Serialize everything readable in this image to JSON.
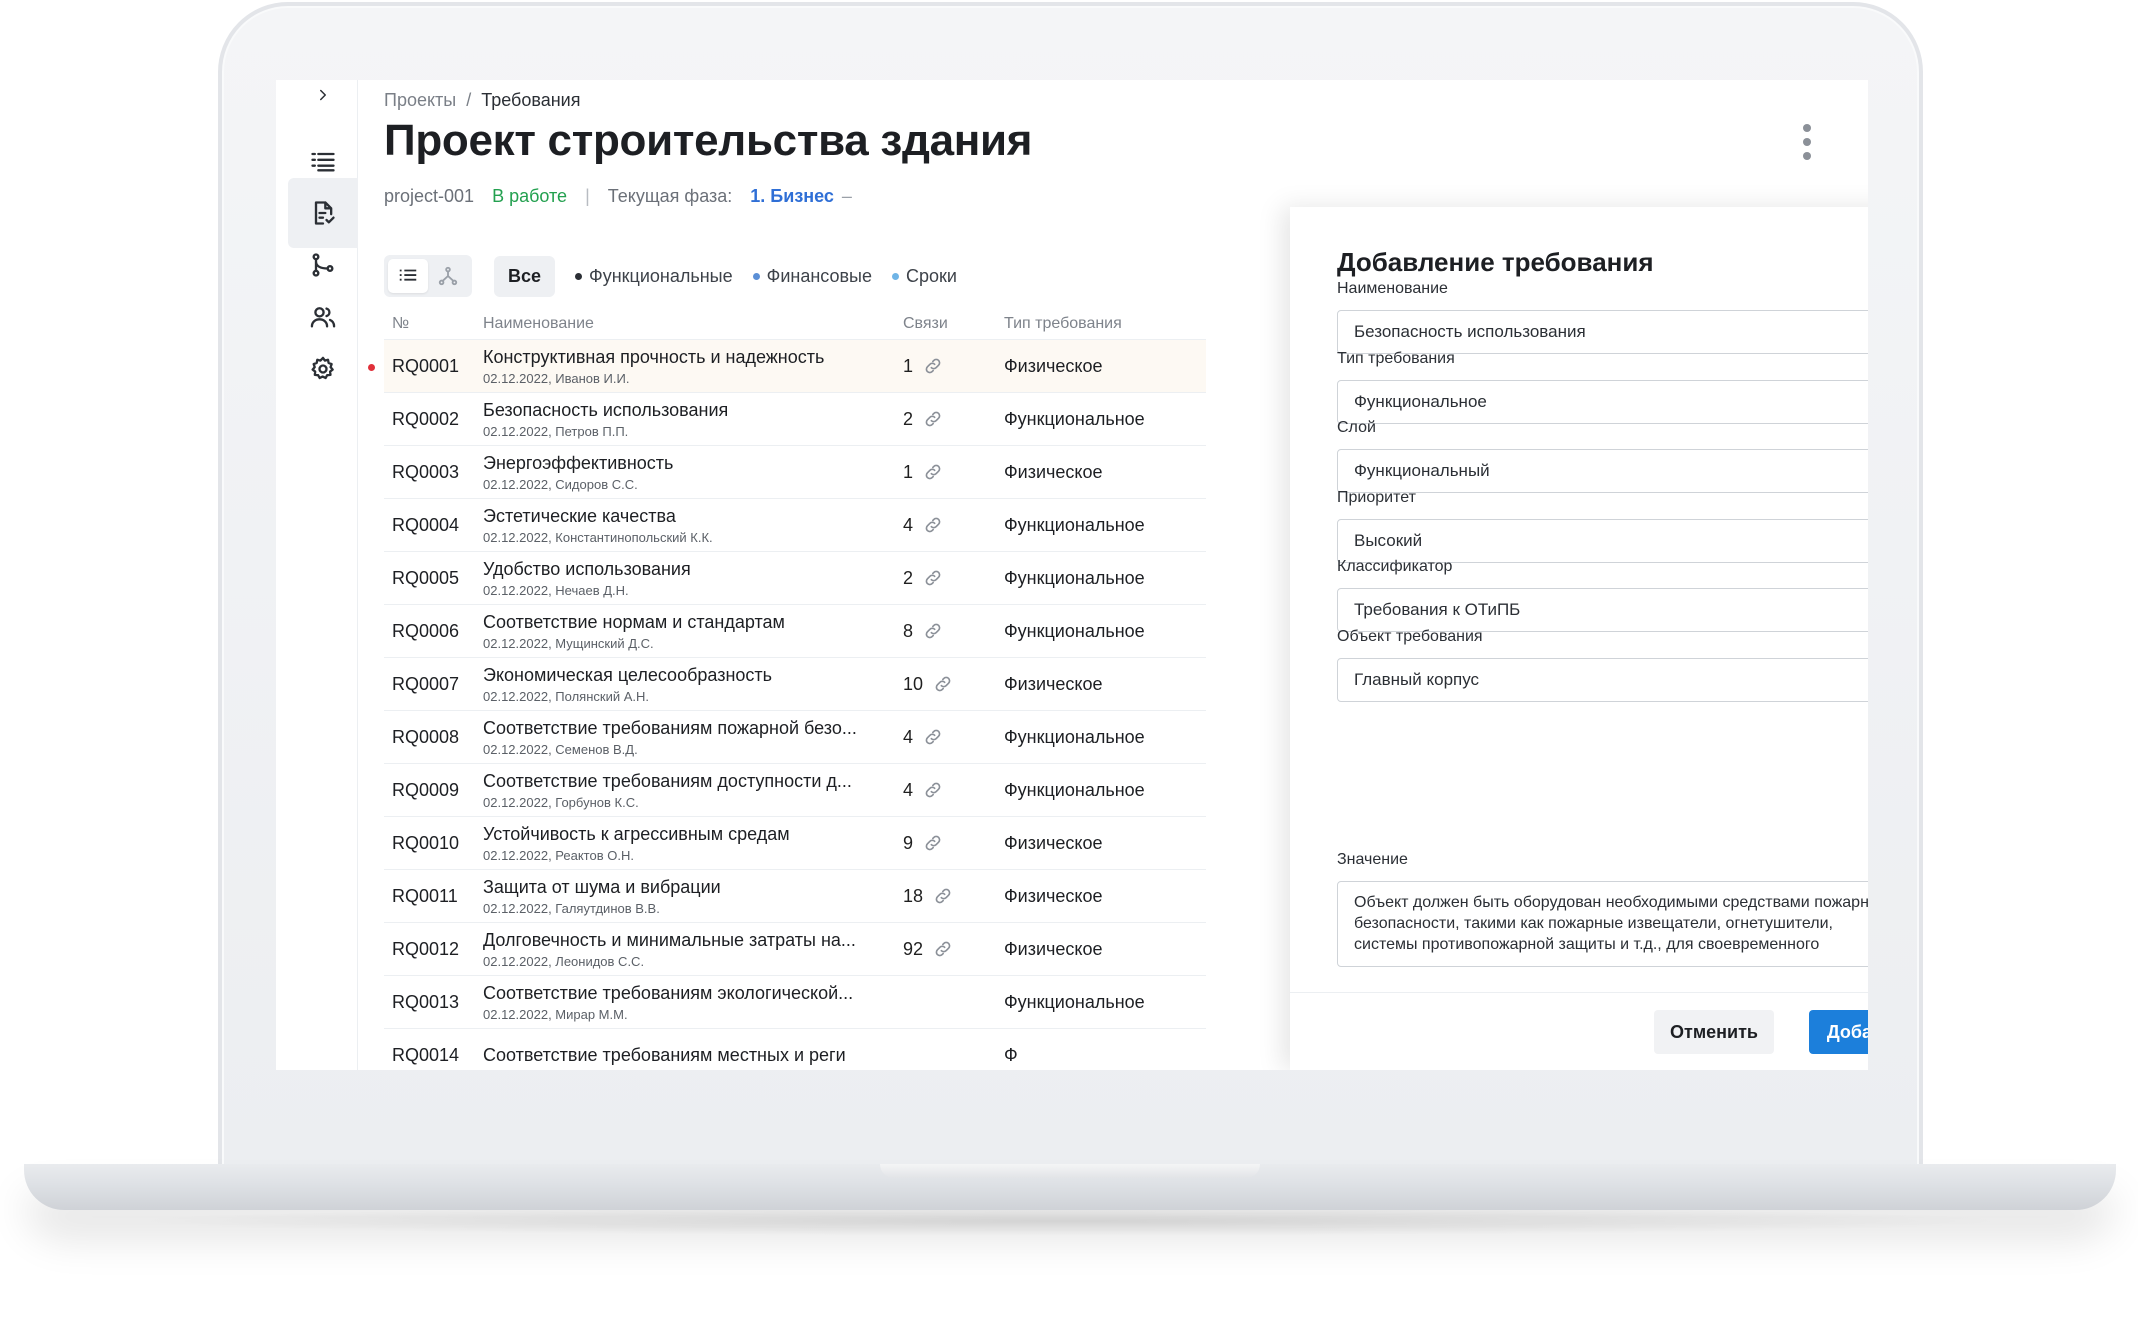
{
  "colors": {
    "accent": "#1c7fdb",
    "status_active": "#23a04f",
    "phase": "#2f6fd6",
    "alert_dot": "#e0303a"
  },
  "rail": {
    "expand_icon": "chevron-right-icon",
    "items": [
      {
        "icon": "list-icon",
        "active": false
      },
      {
        "icon": "document-check-icon",
        "active": true
      },
      {
        "icon": "branch-icon",
        "active": false
      },
      {
        "icon": "users-icon",
        "active": false
      },
      {
        "icon": "gear-icon",
        "active": false
      }
    ]
  },
  "header": {
    "breadcrumb": {
      "root": "Проекты",
      "separator": "/",
      "current": "Требования"
    },
    "title": "Проект строительства здания",
    "project_id": "project-001",
    "status": "В работе",
    "divider": "|",
    "phase_label": "Текущая фаза:",
    "phase_value": "1. Бизнес",
    "phase_dash": "–"
  },
  "toolbar": {
    "filters": [
      {
        "label": "Все",
        "active": true
      },
      {
        "label": "Функциональные",
        "dot_color": "#2b2f35"
      },
      {
        "label": "Финансовые",
        "dot_color": "#5b8fd6"
      },
      {
        "label": "Сроки",
        "dot_color": "#6fb4e6"
      }
    ]
  },
  "table": {
    "columns": [
      "№",
      "Наименование",
      "Связи",
      "Тип требования"
    ],
    "rows": [
      {
        "num": "RQ0001",
        "title": "Конструктивная прочность и надежность",
        "sub": "02.12.2022, Иванов И.И.",
        "links": "1",
        "type": "Физическое",
        "flag": true
      },
      {
        "num": "RQ0002",
        "title": "Безопасность использования",
        "sub": "02.12.2022, Петров П.П.",
        "links": "2",
        "type": "Функциональное"
      },
      {
        "num": "RQ0003",
        "title": "Энергоэффективность",
        "sub": "02.12.2022, Сидоров С.С.",
        "links": "1",
        "type": "Физическое"
      },
      {
        "num": "RQ0004",
        "title": "Эстетические качества",
        "sub": "02.12.2022, Константинопольский К.К.",
        "links": "4",
        "type": "Функциональное"
      },
      {
        "num": "RQ0005",
        "title": "Удобство использования",
        "sub": "02.12.2022, Нечаев Д.Н.",
        "links": "2",
        "type": "Функциональное"
      },
      {
        "num": "RQ0006",
        "title": "Соответствие нормам и стандартам",
        "sub": "02.12.2022, Мущинский Д.С.",
        "links": "8",
        "type": "Функциональное"
      },
      {
        "num": "RQ0007",
        "title": "Экономическая целесообразность",
        "sub": "02.12.2022, Полянский А.Н.",
        "links": "10",
        "type": "Физическое"
      },
      {
        "num": "RQ0008",
        "title": "Соответствие требованиям пожарной безо...",
        "sub": "02.12.2022, Семенов В.Д.",
        "links": "4",
        "type": "Функциональное"
      },
      {
        "num": "RQ0009",
        "title": "Соответствие требованиям доступности д...",
        "sub": "02.12.2022, Горбунов К.С.",
        "links": "4",
        "type": "Функциональное"
      },
      {
        "num": "RQ0010",
        "title": "Устойчивость к агрессивным средам",
        "sub": "02.12.2022, Реактов О.Н.",
        "links": "9",
        "type": "Физическое"
      },
      {
        "num": "RQ0011",
        "title": "Защита от шума и вибрации",
        "sub": "02.12.2022, Галяутдинов В.В.",
        "links": "18",
        "type": "Физическое"
      },
      {
        "num": "RQ0012",
        "title": "Долговечность и минимальные затраты на...",
        "sub": "02.12.2022, Леонидов С.С.",
        "links": "92",
        "type": "Физическое"
      },
      {
        "num": "RQ0013",
        "title": "Соответствие требованиям экологической...",
        "sub": "02.12.2022, Мирар М.М.",
        "links": "",
        "type": "Функциональное"
      },
      {
        "num": "RQ0014",
        "title": "Соответствие требованиям местных и реги",
        "sub": "",
        "links": "",
        "type": "Ф"
      }
    ]
  },
  "panel": {
    "title": "Добавление требования",
    "fields": [
      {
        "label": "Наименование",
        "value": "Безопасность использования",
        "kind": "input"
      },
      {
        "label": "Тип требования",
        "value": "Функциональное",
        "kind": "select"
      },
      {
        "label": "Слой",
        "value": "Функциональный",
        "kind": "select"
      },
      {
        "label": "Приоритет",
        "value": "Высокий",
        "kind": "select"
      },
      {
        "label": "Классификатор",
        "value": "Требования к ОТиПБ",
        "kind": "select"
      },
      {
        "label": "Объект требования",
        "value": "Главный корпус",
        "kind": "select"
      }
    ],
    "value_label": "Значение",
    "value_text": "Объект должен быть оборудован необходимыми средствами пожарной безопасности, такими как пожарные извещатели, огнетушители, системы противопожарной защиты и т.д., для своевременного",
    "cancel_label": "Отменить",
    "add_label": "Добавить"
  }
}
